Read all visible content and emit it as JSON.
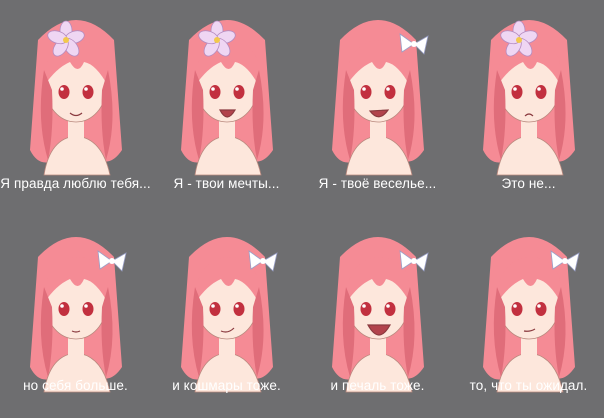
{
  "colors": {
    "background": "#6e6e70",
    "hair": "#f58b95",
    "hair_shade": "#e06d7a",
    "skin": "#fde7dc",
    "eye": "#c2303f",
    "flower": "#efd6f3",
    "bow": "#ffffff",
    "caption_text": "#ffffff"
  },
  "panels": [
    {
      "caption": "Я правда люблю тебя...",
      "accessory": "flower-icon",
      "expression": "smile"
    },
    {
      "caption": "Я - твои мечты...",
      "accessory": "flower-icon",
      "expression": "open-smile"
    },
    {
      "caption": "Я - твоё веселье...",
      "accessory": "bow-icon",
      "expression": "grin"
    },
    {
      "caption": "Это не...",
      "accessory": "flower-icon",
      "expression": "worried"
    },
    {
      "caption": "но себя больше.",
      "accessory": "bow-icon",
      "expression": "calm"
    },
    {
      "caption": "и кошмары тоже.",
      "accessory": "bow-icon",
      "expression": "smirk"
    },
    {
      "caption": "и печаль тоже.",
      "accessory": "bow-icon",
      "expression": "laugh"
    },
    {
      "caption": "то, что ты ожидал.",
      "accessory": "bow-icon",
      "expression": "sly"
    }
  ]
}
